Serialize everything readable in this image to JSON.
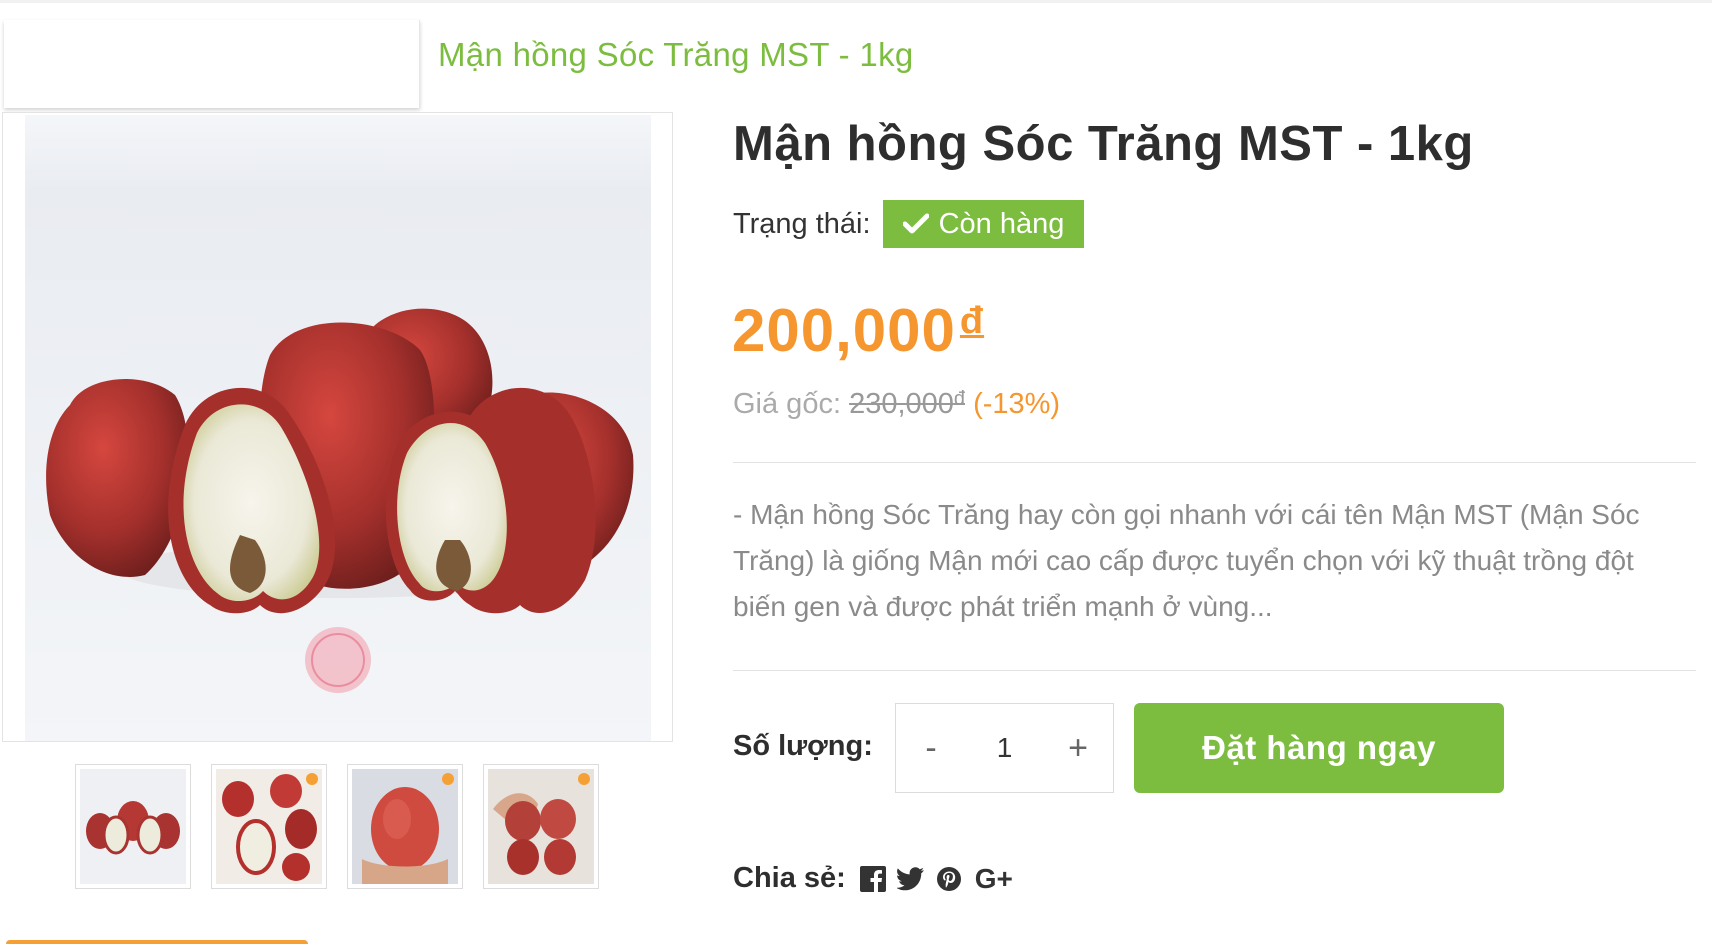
{
  "breadcrumb": {
    "current": "Mận hồng Sóc Trăng MST - 1kg"
  },
  "product": {
    "title": "Mận hồng Sóc Trăng MST - 1kg",
    "status_label": "Trạng thái:",
    "status_value": "Còn hàng",
    "price": "200,000",
    "currency": "đ",
    "original_label": "Giá gốc:",
    "original_price": "230,000",
    "discount": "(-13%)",
    "description": "- Mận hồng Sóc Trăng hay còn gọi nhanh với cái tên Mận MST (Mận Sóc Trăng) là giống Mận mới cao cấp được tuyển chọn với kỹ thuật trồng đột biến gen và được phát triển mạnh ở vùng..."
  },
  "purchase": {
    "quantity_label": "Số lượng:",
    "minus": "-",
    "quantity": "1",
    "plus": "+",
    "order_button": "Đặt hàng ngay"
  },
  "share": {
    "label": "Chia sẻ:",
    "icons": [
      "facebook-icon",
      "twitter-icon",
      "pinterest-icon",
      "google-plus-icon"
    ],
    "gplus_text": "G+"
  },
  "colors": {
    "accent_green": "#7cbd3f",
    "price_orange": "#f5962e",
    "title_dark": "#2e2e2e"
  },
  "thumbnails": [
    "thumb-1",
    "thumb-2",
    "thumb-3",
    "thumb-4"
  ]
}
